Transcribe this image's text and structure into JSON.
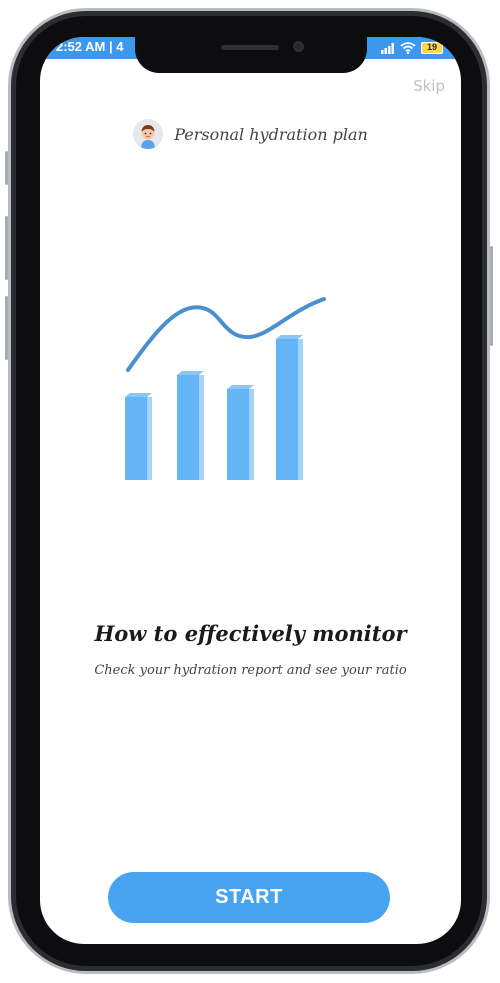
{
  "status_bar": {
    "time": "2:52 AM | 4",
    "battery": "19",
    "color": "#3c98ec"
  },
  "header": {
    "skip_label": "Skip",
    "plan_label": "Personal hydration plan",
    "avatar_icon": "user-avatar-icon"
  },
  "illustration": {
    "icon": "bar-chart-trend-icon",
    "color": "#64b5f6",
    "line_color": "#4a8fd0"
  },
  "content": {
    "title": "How to effectively monitor",
    "subtitle": "Check your hydration report and see your ratio"
  },
  "footer": {
    "start_label": "START",
    "button_color": "#48a4f0"
  }
}
